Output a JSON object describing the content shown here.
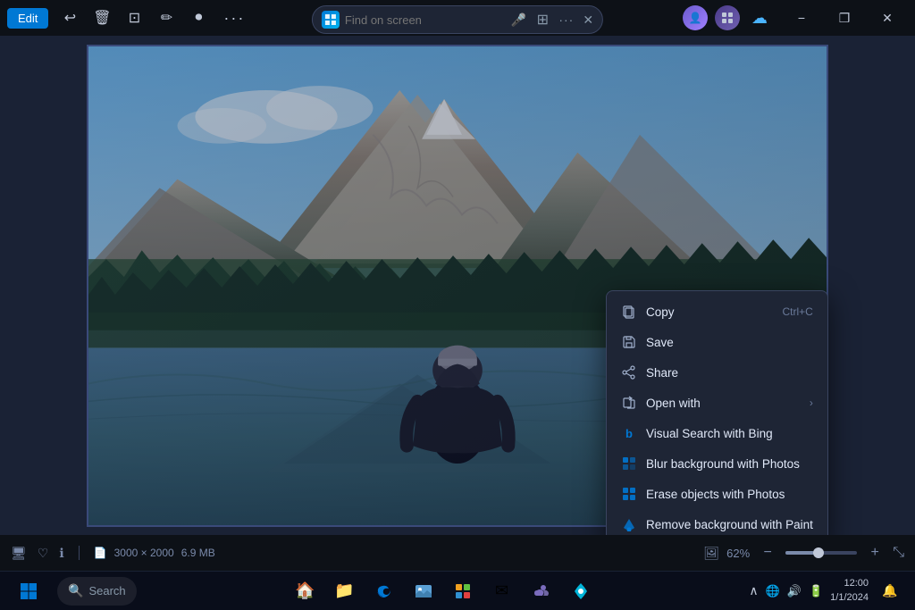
{
  "titlebar": {
    "edit_label": "Edit",
    "more_label": "···"
  },
  "snipbar": {
    "placeholder": "Find on screen",
    "dots": "···",
    "close": "✕"
  },
  "wincontrols": {
    "minimize": "−",
    "maximize": "❐",
    "close": "✕"
  },
  "context_menu": {
    "items": [
      {
        "label": "Copy",
        "shortcut": "Ctrl+C",
        "icon": "copy",
        "has_arrow": false
      },
      {
        "label": "Save",
        "shortcut": "",
        "icon": "save",
        "has_arrow": false
      },
      {
        "label": "Share",
        "shortcut": "",
        "icon": "share",
        "has_arrow": false
      },
      {
        "label": "Open with",
        "shortcut": "",
        "icon": "openwith",
        "has_arrow": true
      },
      {
        "label": "Visual Search with Bing",
        "shortcut": "",
        "icon": "bing",
        "has_arrow": false
      },
      {
        "label": "Blur background with Photos",
        "shortcut": "",
        "icon": "photos-blur",
        "has_arrow": false
      },
      {
        "label": "Erase objects with Photos",
        "shortcut": "",
        "icon": "photos-erase",
        "has_arrow": false
      },
      {
        "label": "Remove background with Paint",
        "shortcut": "",
        "icon": "paint-remove",
        "has_arrow": false
      }
    ]
  },
  "statusbar": {
    "dimensions": "3000 × 2000",
    "filesize": "6.9 MB",
    "zoom": "62%"
  },
  "taskbar": {
    "search_placeholder": "Search",
    "time": "12:00",
    "date": "1/1/2024"
  }
}
